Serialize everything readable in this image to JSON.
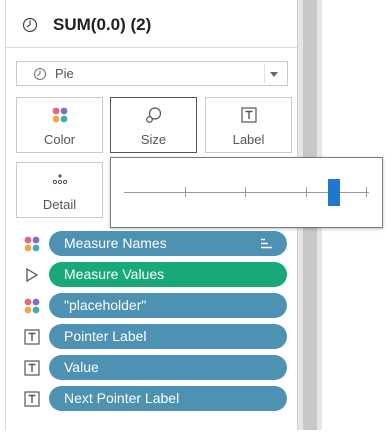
{
  "panel": {
    "title": "SUM(0.0) (2)",
    "mark_type": {
      "selected": "Pie"
    }
  },
  "encodings": {
    "color": "Color",
    "size": "Size",
    "label": "Label",
    "detail": "Detail"
  },
  "size_slider": {
    "ticks": 4,
    "value_fraction": 0.87
  },
  "pills": [
    {
      "label": "Measure Names",
      "icon": "color-dots-icon",
      "color": "#4d91b3"
    },
    {
      "label": "Measure Values",
      "icon": "size-triangle-icon",
      "color": "#17a97a"
    },
    {
      "label": "\"placeholder\"",
      "icon": "color-dots-icon",
      "color": "#4d91b3"
    },
    {
      "label": "Pointer Label",
      "icon": "text-label-icon",
      "color": "#4d91b3"
    },
    {
      "label": "Value",
      "icon": "text-label-icon",
      "color": "#4d91b3"
    },
    {
      "label": "Next Pointer Label",
      "icon": "text-label-icon",
      "color": "#4d91b3"
    }
  ],
  "colors": {
    "accent_blue_pill": "#4d91b3",
    "accent_green_pill": "#17a97a",
    "slider_thumb": "#1f77d0"
  }
}
